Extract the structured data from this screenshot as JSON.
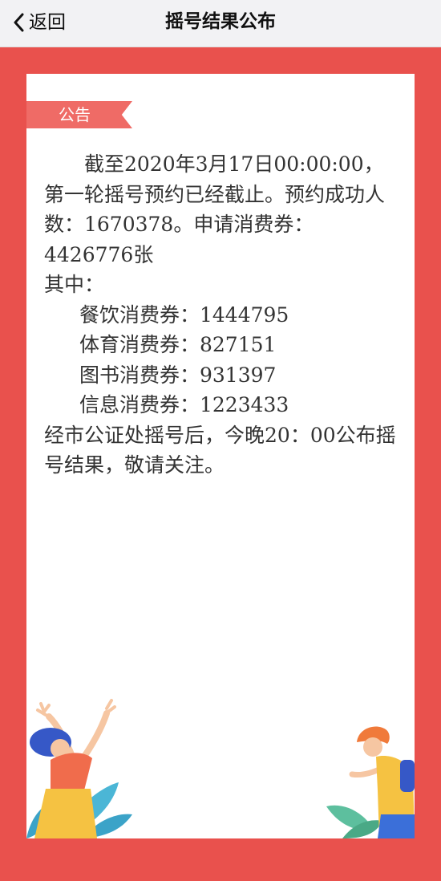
{
  "nav": {
    "back_label": "返回",
    "title": "摇号结果公布"
  },
  "notice": {
    "tag": "公告",
    "intro": "截至2020年3月17日00:00:00，第一轮摇号预约已经截止。预约成功人数：1670378。申请消费券：4426776张",
    "among_label": "其中：",
    "items": [
      {
        "text": "餐饮消费券：1444795"
      },
      {
        "text": "体育消费券：827151"
      },
      {
        "text": "图书消费券：931397"
      },
      {
        "text": "信息消费券：1223433"
      }
    ],
    "closing": "经市公证处摇号后，今晚20：00公布摇号结果，敬请关注。"
  },
  "colors": {
    "frame": "#e9514d",
    "ribbon": "#ef6b66",
    "nav_bg": "#f2f2f4"
  },
  "icons": {
    "back": "chevron-left-icon"
  }
}
